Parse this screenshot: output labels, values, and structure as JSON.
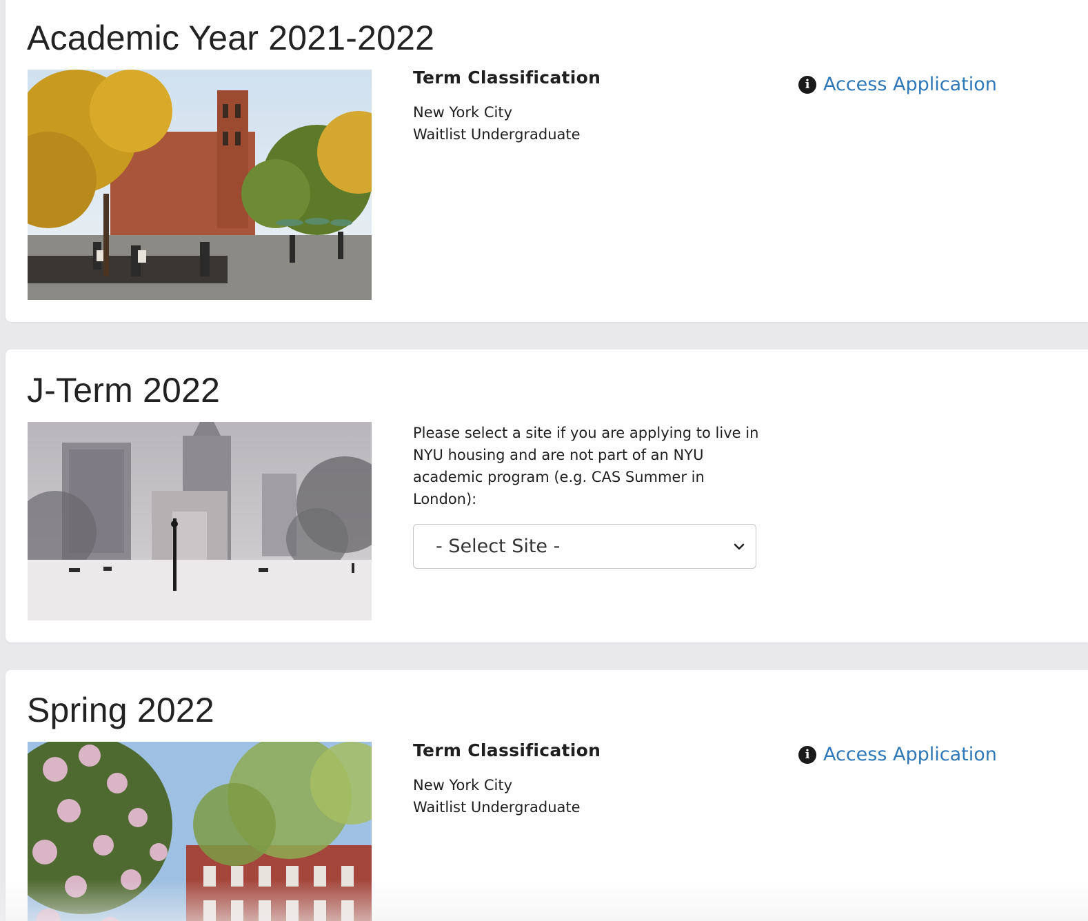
{
  "terms": [
    {
      "title": "Academic Year 2021-2022",
      "photo": "fall-washington-square-park",
      "classification": {
        "heading": "Term Classification",
        "location": "New York City",
        "type": "Waitlist Undergraduate"
      },
      "access_link": {
        "label": "Access Application",
        "icon": "info-icon"
      }
    },
    {
      "title": "J-Term 2022",
      "photo": "winter-washington-square-arch",
      "site_note": "Please select a site if you are applying to live in NYU housing and are not part of an NYU academic program (e.g. CAS Summer in London):",
      "site_select": {
        "selected": "- Select Site -",
        "icon": "chevron-down-icon"
      }
    },
    {
      "title": "Spring 2022",
      "photo": "spring-blossoms-townhouses",
      "classification": {
        "heading": "Term Classification",
        "location": "New York City",
        "type": "Waitlist Undergraduate"
      },
      "access_link": {
        "label": "Access Application",
        "icon": "info-icon"
      }
    }
  ],
  "colors": {
    "page_background": "#e9e9ec",
    "card_background": "#ffffff",
    "link": "#2f78b7",
    "text": "#1f1f1f"
  }
}
